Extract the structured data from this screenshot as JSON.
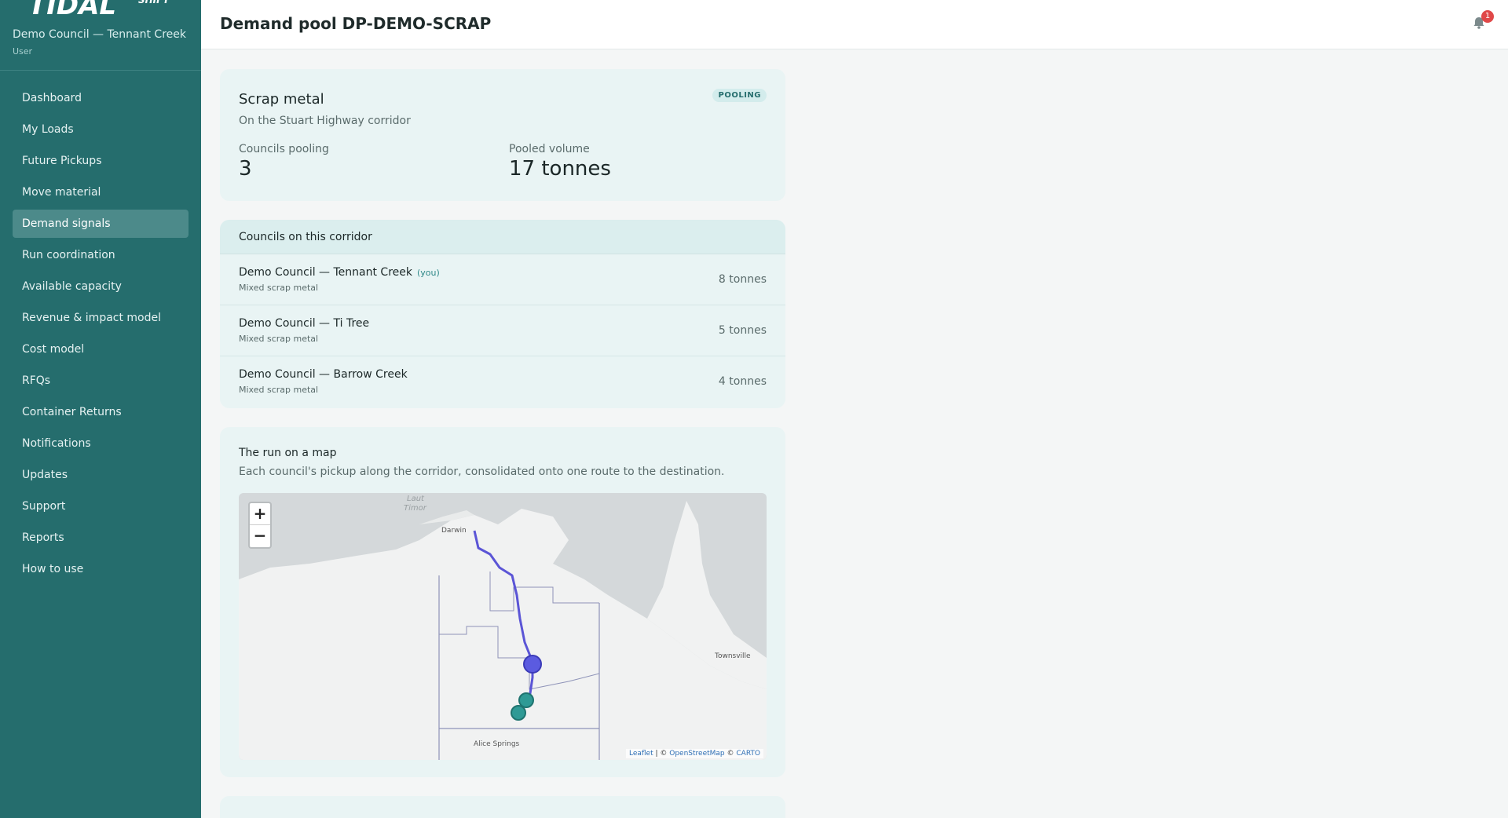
{
  "sidebar": {
    "org_name": "Demo Council — Tennant Creek",
    "role": "User",
    "items": [
      {
        "label": "Dashboard"
      },
      {
        "label": "My Loads"
      },
      {
        "label": "Future Pickups"
      },
      {
        "label": "Move material"
      },
      {
        "label": "Demand signals",
        "active": true
      },
      {
        "label": "Run coordination"
      },
      {
        "label": "Available capacity"
      },
      {
        "label": "Revenue & impact model"
      },
      {
        "label": "Cost model"
      },
      {
        "label": "RFQs"
      },
      {
        "label": "Container Returns"
      },
      {
        "label": "Notifications"
      },
      {
        "label": "Updates"
      },
      {
        "label": "Support"
      },
      {
        "label": "Reports"
      },
      {
        "label": "How to use"
      }
    ]
  },
  "header": {
    "title": "Demand pool DP-DEMO-SCRAP",
    "notification_count": "1"
  },
  "summary": {
    "title": "Scrap metal",
    "subtitle": "On the Stuart Highway corridor",
    "status": "POOLING",
    "councils_label": "Councils pooling",
    "councils_value": "3",
    "volume_label": "Pooled volume",
    "volume_value": "17 tonnes"
  },
  "councils": {
    "heading": "Councils on this corridor",
    "you_label": "(you)",
    "rows": [
      {
        "name": "Demo Council — Tennant Creek",
        "material": "Mixed scrap metal",
        "qty": "8 tonnes"
      },
      {
        "name": "Demo Council — Ti Tree",
        "material": "Mixed scrap metal",
        "qty": "5 tonnes"
      },
      {
        "name": "Demo Council — Barrow Creek",
        "material": "Mixed scrap metal",
        "qty": "4 tonnes"
      }
    ]
  },
  "map": {
    "title": "The run on a map",
    "subtitle": "Each council's pickup along the corridor, consolidated onto one route to the destination.",
    "zoom_in": "+",
    "zoom_out": "−",
    "labels": {
      "sea": "Laut",
      "sea2": "Timor",
      "darwin": "Darwin",
      "townsville": "Townsville",
      "alice": "Alice Springs"
    },
    "attribution": {
      "leaflet": "Leaflet",
      "sep": " | © ",
      "osm": "OpenStreetMap",
      "carto_sep": " © ",
      "carto": "CARTO"
    },
    "colors": {
      "route": "#5b55d6",
      "destination": "#5b5be0",
      "pickup": "#2f9a95"
    }
  }
}
